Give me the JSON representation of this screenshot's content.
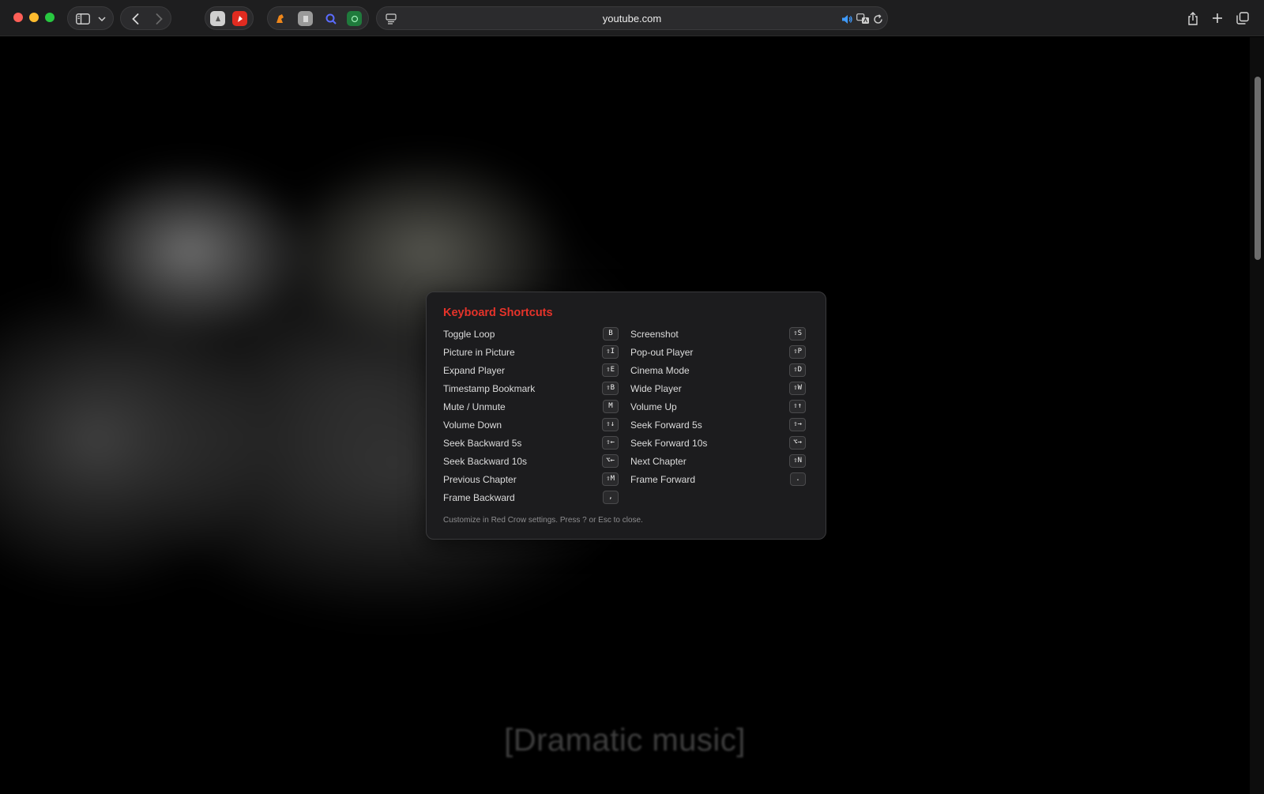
{
  "browser": {
    "url": "youtube.com",
    "icons": {
      "sidebar": "sidebar-icon",
      "chevron": "chevron-down-icon",
      "back": "back-arrow-icon",
      "forward": "forward-arrow-icon",
      "reader": "reader-icon",
      "sound": "speaker-icon",
      "translate": "translate-icon",
      "reload": "reload-icon",
      "share": "share-icon",
      "new_tab": "plus-icon",
      "tabs": "tab-overview-icon"
    },
    "extensions": [
      {
        "name": "extension-1-icon",
        "color": "#cfcfcf"
      },
      {
        "name": "extension-2-icon",
        "color": "#e02b20"
      },
      {
        "name": "red-crow-extension-icon",
        "color": "#f0871a"
      },
      {
        "name": "extension-4-icon",
        "color": "#9a9a9a"
      },
      {
        "name": "magnifier-extension-icon",
        "color": "#5b6cff"
      },
      {
        "name": "extension-6-icon",
        "color": "#1f7a3c"
      }
    ]
  },
  "video": {
    "caption": "[Dramatic music]"
  },
  "shortcuts": {
    "title": "Keyboard Shortcuts",
    "title_color": "#e5332a",
    "left": [
      {
        "label": "Toggle Loop",
        "key": "B"
      },
      {
        "label": "Picture in Picture",
        "key": "⇧I"
      },
      {
        "label": "Expand Player",
        "key": "⇧E"
      },
      {
        "label": "Timestamp Bookmark",
        "key": "⇧B"
      },
      {
        "label": "Mute / Unmute",
        "key": "M"
      },
      {
        "label": "Volume Down",
        "key": "⇧↓"
      },
      {
        "label": "Seek Backward 5s",
        "key": "⇧←"
      },
      {
        "label": "Seek Backward 10s",
        "key": "⌥←"
      },
      {
        "label": "Previous Chapter",
        "key": "⇧M"
      },
      {
        "label": "Frame Backward",
        "key": ","
      }
    ],
    "right": [
      {
        "label": "Screenshot",
        "key": "⇧S"
      },
      {
        "label": "Pop-out Player",
        "key": "⇧P"
      },
      {
        "label": "Cinema Mode",
        "key": "⇧D"
      },
      {
        "label": "Wide Player",
        "key": "⇧W"
      },
      {
        "label": "Volume Up",
        "key": "⇧↑"
      },
      {
        "label": "Seek Forward 5s",
        "key": "⇧→"
      },
      {
        "label": "Seek Forward 10s",
        "key": "⌥→"
      },
      {
        "label": "Next Chapter",
        "key": "⇧N"
      },
      {
        "label": "Frame Forward",
        "key": "."
      }
    ],
    "footer": "Customize in Red Crow settings. Press ? or Esc to close."
  }
}
